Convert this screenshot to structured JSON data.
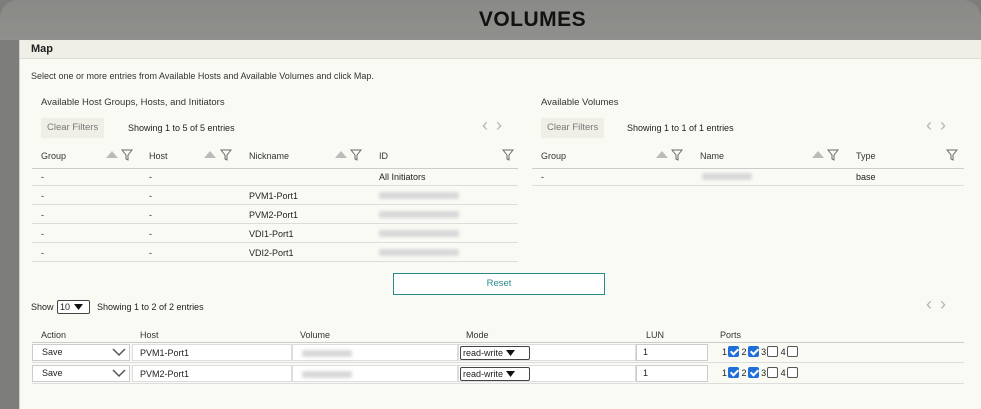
{
  "page_title": "VOLUMES",
  "dialog": {
    "title": "Map",
    "instructions": "Select one or more entries from Available Hosts and Available Volumes and click Map."
  },
  "hosts_panel": {
    "title": "Available Host Groups, Hosts, and Initiators",
    "clear_filters": "Clear Filters",
    "showing": "Showing 1 to 5 of 5 entries",
    "columns": [
      "Group",
      "Host",
      "Nickname",
      "ID"
    ],
    "rows": [
      {
        "group": "-",
        "host": "-",
        "nickname": "",
        "id": "All Initiators",
        "id_blurred": false
      },
      {
        "group": "-",
        "host": "-",
        "nickname": "PVM1-Port1",
        "id": "",
        "id_blurred": true
      },
      {
        "group": "-",
        "host": "-",
        "nickname": "PVM2-Port1",
        "id": "",
        "id_blurred": true
      },
      {
        "group": "-",
        "host": "-",
        "nickname": "VDI1-Port1",
        "id": "",
        "id_blurred": true
      },
      {
        "group": "-",
        "host": "-",
        "nickname": "VDI2-Port1",
        "id": "",
        "id_blurred": true
      }
    ]
  },
  "volumes_panel": {
    "title": "Available Volumes",
    "clear_filters": "Clear Filters",
    "showing": "Showing 1 to 1 of 1 entries",
    "columns": [
      "Group",
      "Name",
      "Type"
    ],
    "rows": [
      {
        "group": "-",
        "name": "",
        "name_blurred": true,
        "type": "base"
      }
    ]
  },
  "reset_label": "Reset",
  "mapping": {
    "show_label": "Show",
    "page_size": "10",
    "showing": "Showing 1 to 2 of 2 entries",
    "columns": [
      "Action",
      "Host",
      "Volume",
      "Mode",
      "LUN",
      "Ports"
    ],
    "rows": [
      {
        "action": "Save",
        "host": "PVM1-Port1",
        "volume": "",
        "mode": "read-write",
        "lun": "1",
        "ports": [
          {
            "n": "1",
            "checked": true
          },
          {
            "n": "2",
            "checked": true
          },
          {
            "n": "3",
            "checked": false
          },
          {
            "n": "4",
            "checked": false
          }
        ]
      },
      {
        "action": "Save",
        "host": "PVM2-Port1",
        "volume": "",
        "mode": "read-write",
        "lun": "1",
        "ports": [
          {
            "n": "1",
            "checked": true
          },
          {
            "n": "2",
            "checked": true
          },
          {
            "n": "3",
            "checked": false
          },
          {
            "n": "4",
            "checked": false
          }
        ]
      }
    ]
  },
  "icons": {
    "sort": "sort-arrow-icon",
    "filter": "filter-funnel-icon",
    "prev": "chevron-left-icon",
    "next": "chevron-right-icon",
    "dropdown": "chevron-down-icon"
  },
  "colors": {
    "accent": "#2b8a8c",
    "checkbox": "#1e6fd9"
  }
}
